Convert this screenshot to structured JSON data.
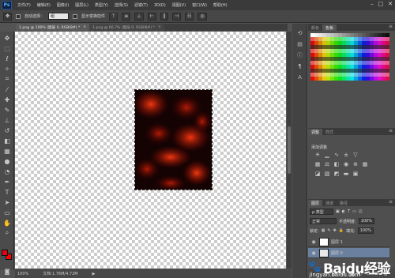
{
  "app": {
    "logo_text": "Ps"
  },
  "menubar": {
    "items": [
      "文件(F)",
      "编辑(E)",
      "图像(I)",
      "图层(L)",
      "类型(Y)",
      "选择(S)",
      "滤镜(T)",
      "3D(D)",
      "视图(V)",
      "窗口(W)",
      "帮助(H)"
    ],
    "window_controls": [
      "–",
      "□",
      "✕"
    ]
  },
  "options_bar": {
    "auto_select_label": "自动选择：",
    "auto_select_value": "组",
    "show_transform_label": "显示变换控件"
  },
  "document_tabs": [
    {
      "label": "1.png @ 100% (图层 0, RGB/8#) *",
      "close": "×",
      "active": true
    },
    {
      "label": "1.png @ 66.7% (图层 0, RGB/8#) *",
      "close": "×",
      "active": false
    }
  ],
  "tools": [
    "move-tool",
    "marquee-tool",
    "lasso-tool",
    "magic-wand-tool",
    "crop-tool",
    "eyedropper-tool",
    "healing-tool",
    "brush-tool",
    "clone-stamp-tool",
    "history-brush-tool",
    "eraser-tool",
    "gradient-tool",
    "blur-tool",
    "dodge-tool",
    "pen-tool",
    "type-tool",
    "path-select-tool",
    "shape-tool",
    "hand-tool",
    "zoom-tool"
  ],
  "colors": {
    "foreground": "#e60012",
    "background": "#ff0000",
    "image_fill": "#150303",
    "image_glow": "#d42a08"
  },
  "status_bar": {
    "zoom": "100%",
    "doc_info": "文档:1.76M/4.72M",
    "arrow": "▶"
  },
  "panels": {
    "color_tabs": [
      "颜色",
      "色板"
    ],
    "adjustments_tabs": [
      "调整",
      "样式"
    ],
    "adjustments_title": "添加调整",
    "layers_tabs": [
      "图层",
      "通道",
      "路径"
    ],
    "layers": {
      "filter_label": "ρ 类型",
      "blend_mode": "正常",
      "opacity_label": "不透明度:",
      "opacity_value": "100%",
      "lock_label": "锁定:",
      "fill_label": "填充:",
      "fill_value": "100%",
      "items": [
        {
          "name": "图层 1",
          "selected": false
        },
        {
          "name": "图层 0",
          "selected": true
        }
      ]
    }
  },
  "watermark": {
    "brand": "Baidu经验",
    "url": "jingyan.baidu.com"
  }
}
